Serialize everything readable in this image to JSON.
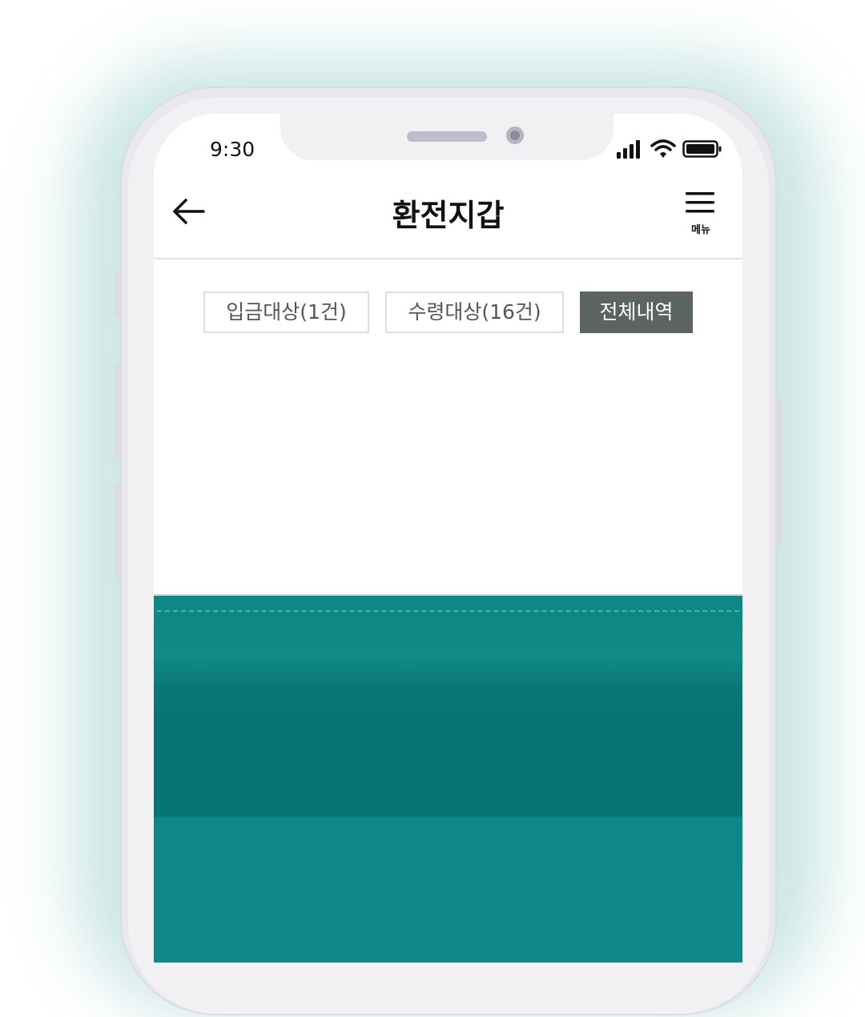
{
  "status_bar": {
    "time": "9:30",
    "icons": [
      "signal-icon",
      "wifi-icon",
      "battery-icon"
    ]
  },
  "header": {
    "title": "환전지갑",
    "back_icon": "arrow-left-icon",
    "menu_icon": "hamburger-menu-icon",
    "menu_label": "메뉴"
  },
  "tabs": [
    {
      "label": "입금대상(1건)",
      "active": false
    },
    {
      "label": "수령대상(16건)",
      "active": false
    },
    {
      "label": "전체내역",
      "active": true
    }
  ],
  "colors": {
    "accent_teal": "#0f8787",
    "active_tab": "#5c6363",
    "tab_border": "#dddddd"
  }
}
